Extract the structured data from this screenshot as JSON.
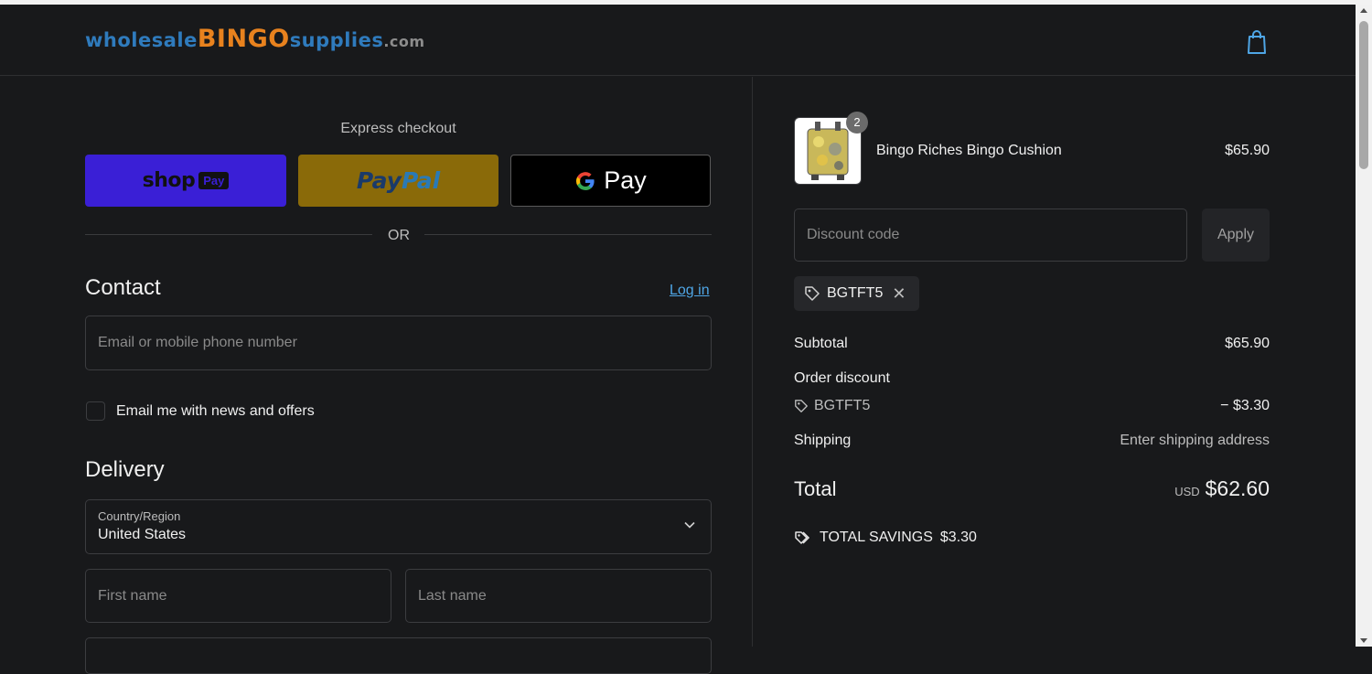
{
  "header": {
    "logo": {
      "part1": "wholesale",
      "part2": "BINGO",
      "part3": "supplies",
      "part4": ".com"
    },
    "cart_icon": "shopping-bag-icon"
  },
  "express": {
    "title": "Express checkout",
    "buttons": [
      {
        "name": "shop",
        "tag": "Pay",
        "color": "#3a1fd6"
      },
      {
        "name_part1": "Pay",
        "name_part2": "Pal",
        "color": "#8a6a09"
      },
      {
        "name": "Pay",
        "icon": "google-g-icon",
        "color": "#000000"
      }
    ],
    "or": "OR"
  },
  "contact": {
    "heading": "Contact",
    "login": "Log in",
    "email_placeholder": "Email or mobile phone number",
    "newsletter_label": "Email me with news and offers"
  },
  "delivery": {
    "heading": "Delivery",
    "country_label": "Country/Region",
    "country_value": "United States",
    "first_name_placeholder": "First name",
    "last_name_placeholder": "Last name"
  },
  "summary": {
    "product": {
      "name": "Bingo Riches Bingo Cushion",
      "price": "$65.90",
      "quantity": "2"
    },
    "discount_placeholder": "Discount code",
    "apply": "Apply",
    "applied_code": "BGTFT5",
    "subtotal_label": "Subtotal",
    "subtotal_value": "$65.90",
    "order_discount_label": "Order discount",
    "discount_code": "BGTFT5",
    "discount_value": "− $3.30",
    "shipping_label": "Shipping",
    "shipping_value": "Enter shipping address",
    "total_label": "Total",
    "total_currency": "USD",
    "total_value": "$62.60",
    "savings_label": "TOTAL SAVINGS",
    "savings_value": "$3.30"
  },
  "colors": {
    "background": "#18191b",
    "accent_link": "#4fa6e6",
    "logo_blue": "#2f7bbd",
    "logo_orange": "#e8821e"
  }
}
